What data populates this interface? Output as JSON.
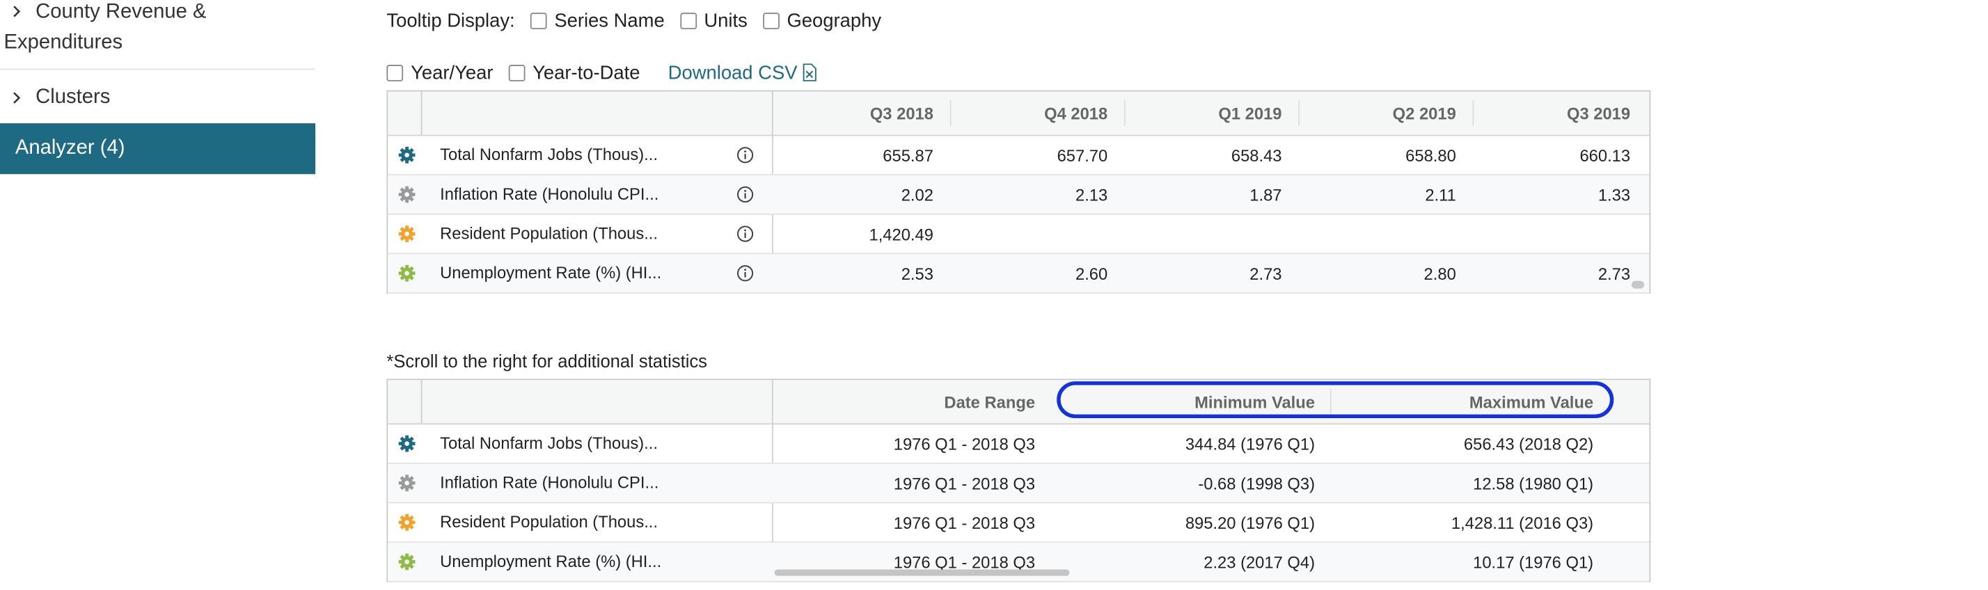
{
  "sidebar": {
    "items": [
      {
        "label_line1": "County Revenue &",
        "label_line2": "Expenditures"
      },
      {
        "label": "Clusters"
      },
      {
        "label": "Analyzer (4)"
      }
    ]
  },
  "toolbar": {
    "tooltip_label": "Tooltip Display:",
    "tooltip_options": [
      "Series Name",
      "Units",
      "Geography"
    ],
    "year_options": [
      "Year/Year",
      "Year-to-Date"
    ],
    "download_label": "Download CSV"
  },
  "colors": {
    "accent": "#1e6a83",
    "highlight": "#1533d6",
    "series_colors": [
      "#1e6a83",
      "#9a9a9a",
      "#f2a12b",
      "#8dbb46"
    ]
  },
  "data_table": {
    "columns": [
      "Q3 2018",
      "Q4 2018",
      "Q1 2019",
      "Q2 2019",
      "Q3 2019"
    ],
    "rows": [
      {
        "name": "Total Nonfarm Jobs (Thous)...",
        "values": [
          "655.87",
          "657.70",
          "658.43",
          "658.80",
          "660.13"
        ]
      },
      {
        "name": "Inflation Rate (Honolulu CPI...",
        "values": [
          "2.02",
          "2.13",
          "1.87",
          "2.11",
          "1.33"
        ]
      },
      {
        "name": "Resident Population (Thous...",
        "values": [
          "1,420.49",
          "",
          "",
          "",
          ""
        ]
      },
      {
        "name": "Unemployment Rate (%) (HI...",
        "values": [
          "2.53",
          "2.60",
          "2.73",
          "2.80",
          "2.73"
        ]
      }
    ]
  },
  "stats_note": "*Scroll to the right for additional statistics",
  "stats_table": {
    "columns": [
      "Date Range",
      "Minimum Value",
      "Maximum Value"
    ],
    "rows": [
      {
        "name": "Total Nonfarm Jobs (Thous)...",
        "values": [
          "1976 Q1 - 2018 Q3",
          "344.84 (1976 Q1)",
          "656.43 (2018 Q2)"
        ]
      },
      {
        "name": "Inflation Rate (Honolulu CPI...",
        "values": [
          "1976 Q1 - 2018 Q3",
          "-0.68 (1998 Q3)",
          "12.58 (1980 Q1)"
        ]
      },
      {
        "name": "Resident Population (Thous...",
        "values": [
          "1976 Q1 - 2018 Q3",
          "895.20 (1976 Q1)",
          "1,428.11 (2016 Q3)"
        ]
      },
      {
        "name": "Unemployment Rate (%) (HI...",
        "values": [
          "1976 Q1 - 2018 Q3",
          "2.23 (2017 Q4)",
          "10.17 (1976 Q1)"
        ]
      }
    ]
  }
}
